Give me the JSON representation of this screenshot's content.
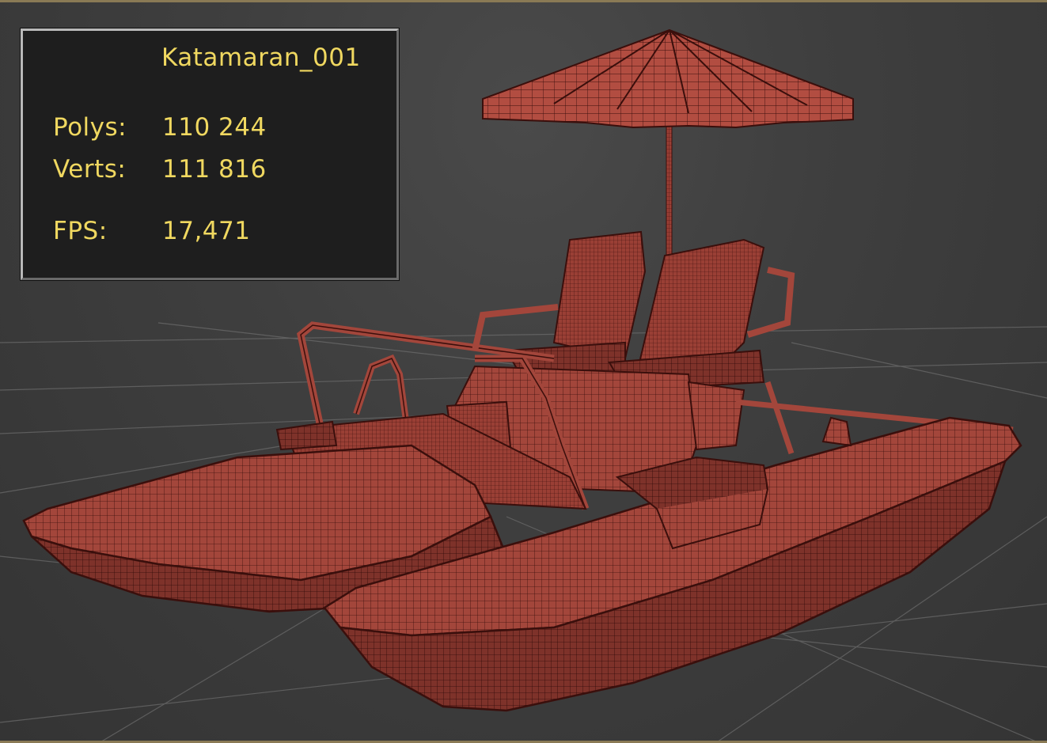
{
  "stats": {
    "object_name": "Katamaran_001",
    "polys_label": "Polys:",
    "polys_value": "110 244",
    "verts_label": "Verts:",
    "verts_value": "111 816",
    "fps_label": "FPS:",
    "fps_value": "17,471"
  },
  "colors": {
    "stats_text": "#f0d860",
    "stats_bg": "#1e1e1e",
    "model_fill": "#a3463b",
    "model_wire": "#3a0f0c",
    "grid_line": "#6e6e6e",
    "viewport_border": "#8a7a55"
  },
  "icons": {
    "model": "pedal-boat-wireframe-icon"
  }
}
